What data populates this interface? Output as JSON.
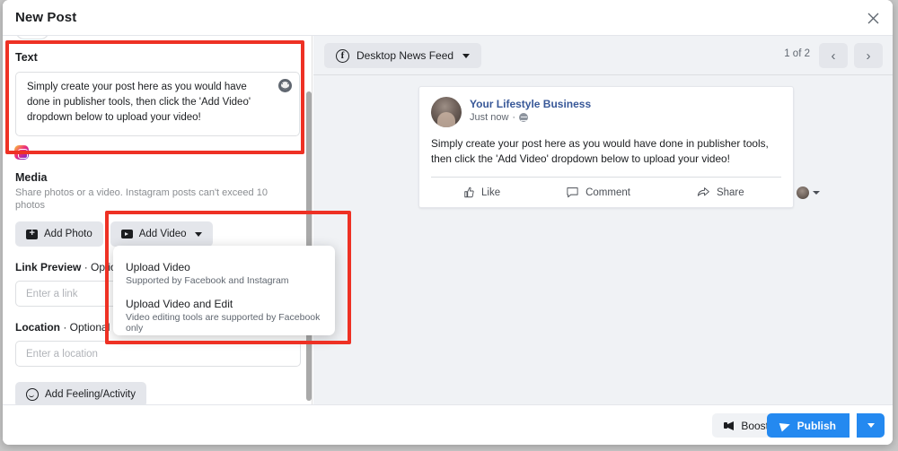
{
  "window": {
    "title": "New Post",
    "close_icon": "close-icon"
  },
  "form": {
    "text_section": {
      "label": "Text",
      "value": "Simply create your post here as you would have done in publisher tools, then click the 'Add Video' dropdown below to upload your video!",
      "emoji_icon": "emoji-smiley-icon",
      "instagram_icon": "instagram-icon"
    },
    "media_section": {
      "label": "Media",
      "description": "Share photos or a video. Instagram posts can't exceed 10 photos",
      "add_photo_label": "Add Photo",
      "add_photo_icon": "photo-icon",
      "add_video_label": "Add Video",
      "add_video_icon": "video-icon",
      "add_video_caret_icon": "chevron-down-icon"
    },
    "link_preview": {
      "label": "Link Preview",
      "optional_suffix": "· Optional",
      "placeholder": "Enter a link"
    },
    "location": {
      "label": "Location",
      "optional_suffix": "· Optional",
      "placeholder": "Enter a location"
    },
    "feeling_button": {
      "label": "Add Feeling/Activity",
      "icon": "smiley-icon"
    }
  },
  "dropdown": {
    "items": [
      {
        "title": "Upload Video",
        "subtitle": "Supported by Facebook and Instagram"
      },
      {
        "title": "Upload Video and Edit",
        "subtitle": "Video editing tools are supported by Facebook only"
      }
    ]
  },
  "preview": {
    "feed_selector": {
      "label": "Desktop News Feed",
      "brand_icon": "facebook-icon",
      "caret_icon": "chevron-down-icon"
    },
    "pagination": {
      "count_label": "1 of 2",
      "prev_icon": "chevron-left-icon",
      "next_icon": "chevron-right-icon",
      "prev_glyph": "‹",
      "next_glyph": "›"
    },
    "post": {
      "page_name": "Your Lifestyle Business",
      "timestamp": "Just now",
      "separator": "·",
      "privacy_icon": "globe-icon",
      "body": "Simply create your post here as you would have done in publisher tools, then click the 'Add Video' dropdown below to upload your video!",
      "actions": [
        {
          "label": "Like",
          "icon": "thumbs-up-icon"
        },
        {
          "label": "Comment",
          "icon": "comment-bubble-icon"
        },
        {
          "label": "Share",
          "icon": "share-arrow-icon"
        }
      ],
      "avatar_icon": "profile-avatar",
      "account_caret_icon": "chevron-down-icon"
    }
  },
  "footer": {
    "boost_label": "Boost",
    "boost_icon": "megaphone-icon",
    "publish_label": "Publish",
    "publish_icon": "send-plane-icon",
    "publish_caret_icon": "chevron-down-icon"
  },
  "colors": {
    "accent_blue": "#2489f0",
    "annotation_red": "#ee3124",
    "link_blue": "#385898",
    "panel_gray": "#f0f2f5"
  }
}
